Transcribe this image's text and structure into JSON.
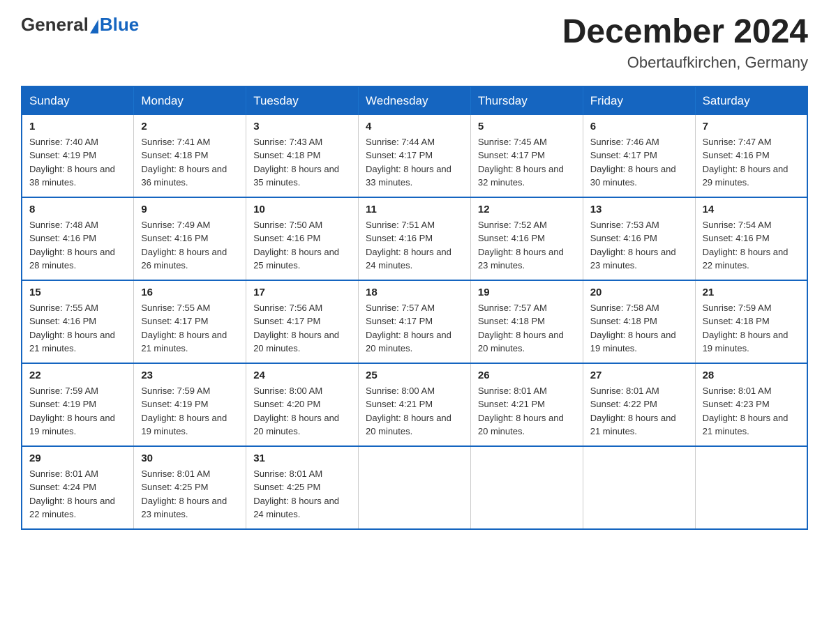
{
  "header": {
    "logo_general": "General",
    "logo_blue": "Blue",
    "month_title": "December 2024",
    "location": "Obertaufkirchen, Germany"
  },
  "days_of_week": [
    "Sunday",
    "Monday",
    "Tuesday",
    "Wednesday",
    "Thursday",
    "Friday",
    "Saturday"
  ],
  "weeks": [
    [
      {
        "day": "1",
        "sunrise": "7:40 AM",
        "sunset": "4:19 PM",
        "daylight": "8 hours and 38 minutes."
      },
      {
        "day": "2",
        "sunrise": "7:41 AM",
        "sunset": "4:18 PM",
        "daylight": "8 hours and 36 minutes."
      },
      {
        "day": "3",
        "sunrise": "7:43 AM",
        "sunset": "4:18 PM",
        "daylight": "8 hours and 35 minutes."
      },
      {
        "day": "4",
        "sunrise": "7:44 AM",
        "sunset": "4:17 PM",
        "daylight": "8 hours and 33 minutes."
      },
      {
        "day": "5",
        "sunrise": "7:45 AM",
        "sunset": "4:17 PM",
        "daylight": "8 hours and 32 minutes."
      },
      {
        "day": "6",
        "sunrise": "7:46 AM",
        "sunset": "4:17 PM",
        "daylight": "8 hours and 30 minutes."
      },
      {
        "day": "7",
        "sunrise": "7:47 AM",
        "sunset": "4:16 PM",
        "daylight": "8 hours and 29 minutes."
      }
    ],
    [
      {
        "day": "8",
        "sunrise": "7:48 AM",
        "sunset": "4:16 PM",
        "daylight": "8 hours and 28 minutes."
      },
      {
        "day": "9",
        "sunrise": "7:49 AM",
        "sunset": "4:16 PM",
        "daylight": "8 hours and 26 minutes."
      },
      {
        "day": "10",
        "sunrise": "7:50 AM",
        "sunset": "4:16 PM",
        "daylight": "8 hours and 25 minutes."
      },
      {
        "day": "11",
        "sunrise": "7:51 AM",
        "sunset": "4:16 PM",
        "daylight": "8 hours and 24 minutes."
      },
      {
        "day": "12",
        "sunrise": "7:52 AM",
        "sunset": "4:16 PM",
        "daylight": "8 hours and 23 minutes."
      },
      {
        "day": "13",
        "sunrise": "7:53 AM",
        "sunset": "4:16 PM",
        "daylight": "8 hours and 23 minutes."
      },
      {
        "day": "14",
        "sunrise": "7:54 AM",
        "sunset": "4:16 PM",
        "daylight": "8 hours and 22 minutes."
      }
    ],
    [
      {
        "day": "15",
        "sunrise": "7:55 AM",
        "sunset": "4:16 PM",
        "daylight": "8 hours and 21 minutes."
      },
      {
        "day": "16",
        "sunrise": "7:55 AM",
        "sunset": "4:17 PM",
        "daylight": "8 hours and 21 minutes."
      },
      {
        "day": "17",
        "sunrise": "7:56 AM",
        "sunset": "4:17 PM",
        "daylight": "8 hours and 20 minutes."
      },
      {
        "day": "18",
        "sunrise": "7:57 AM",
        "sunset": "4:17 PM",
        "daylight": "8 hours and 20 minutes."
      },
      {
        "day": "19",
        "sunrise": "7:57 AM",
        "sunset": "4:18 PM",
        "daylight": "8 hours and 20 minutes."
      },
      {
        "day": "20",
        "sunrise": "7:58 AM",
        "sunset": "4:18 PM",
        "daylight": "8 hours and 19 minutes."
      },
      {
        "day": "21",
        "sunrise": "7:59 AM",
        "sunset": "4:18 PM",
        "daylight": "8 hours and 19 minutes."
      }
    ],
    [
      {
        "day": "22",
        "sunrise": "7:59 AM",
        "sunset": "4:19 PM",
        "daylight": "8 hours and 19 minutes."
      },
      {
        "day": "23",
        "sunrise": "7:59 AM",
        "sunset": "4:19 PM",
        "daylight": "8 hours and 19 minutes."
      },
      {
        "day": "24",
        "sunrise": "8:00 AM",
        "sunset": "4:20 PM",
        "daylight": "8 hours and 20 minutes."
      },
      {
        "day": "25",
        "sunrise": "8:00 AM",
        "sunset": "4:21 PM",
        "daylight": "8 hours and 20 minutes."
      },
      {
        "day": "26",
        "sunrise": "8:01 AM",
        "sunset": "4:21 PM",
        "daylight": "8 hours and 20 minutes."
      },
      {
        "day": "27",
        "sunrise": "8:01 AM",
        "sunset": "4:22 PM",
        "daylight": "8 hours and 21 minutes."
      },
      {
        "day": "28",
        "sunrise": "8:01 AM",
        "sunset": "4:23 PM",
        "daylight": "8 hours and 21 minutes."
      }
    ],
    [
      {
        "day": "29",
        "sunrise": "8:01 AM",
        "sunset": "4:24 PM",
        "daylight": "8 hours and 22 minutes."
      },
      {
        "day": "30",
        "sunrise": "8:01 AM",
        "sunset": "4:25 PM",
        "daylight": "8 hours and 23 minutes."
      },
      {
        "day": "31",
        "sunrise": "8:01 AM",
        "sunset": "4:25 PM",
        "daylight": "8 hours and 24 minutes."
      },
      null,
      null,
      null,
      null
    ]
  ]
}
